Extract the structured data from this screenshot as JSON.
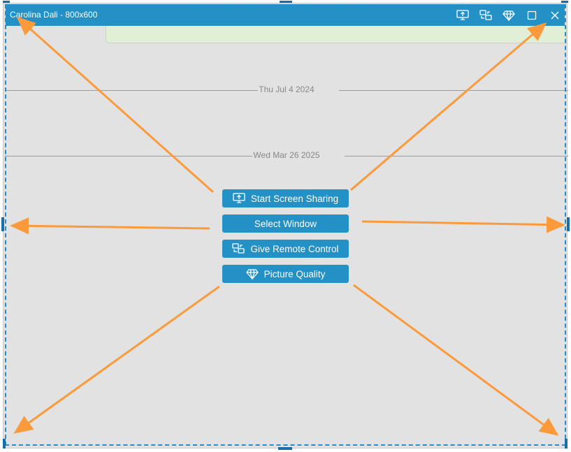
{
  "window": {
    "title": "Carolina Dali - 800x600",
    "titlebar_icons": [
      "screen-share-icon",
      "remote-control-icon",
      "picture-quality-icon",
      "maximize-icon",
      "close-icon"
    ]
  },
  "chat": {
    "date_separators": [
      "Thu Jul 4 2024",
      "Wed Mar 26 2025"
    ]
  },
  "actions": [
    {
      "label": "Start Screen Sharing",
      "icon": "screen-share-icon"
    },
    {
      "label": "Select Window",
      "icon": ""
    },
    {
      "label": "Give Remote Control",
      "icon": "remote-control-icon"
    },
    {
      "label": "Picture Quality",
      "icon": "picture-quality-icon"
    }
  ],
  "colors": {
    "accent": "#2390c6",
    "arrow": "#fb9a3a",
    "background": "#e2e2e2",
    "bubble": "#e1efd6"
  }
}
